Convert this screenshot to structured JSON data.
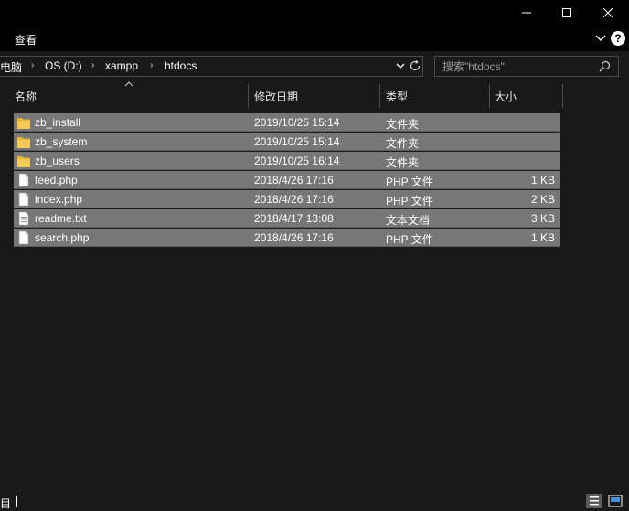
{
  "window": {
    "min_icon": "minimize-icon",
    "max_icon": "maximize-icon",
    "close_icon": "close-icon"
  },
  "ribbon": {
    "tab_view": "查看",
    "help_label": "?"
  },
  "address": {
    "crumbs": [
      "电脑",
      "OS (D:)",
      "xampp",
      "htdocs"
    ],
    "separator": "›"
  },
  "search": {
    "placeholder": "搜索\"htdocs\""
  },
  "columns": {
    "name": "名称",
    "modified": "修改日期",
    "type": "类型",
    "size": "大小"
  },
  "files": [
    {
      "name": "zb_install",
      "modified": "2019/10/25 15:14",
      "type": "文件夹",
      "size": "",
      "icon": "folder-icon"
    },
    {
      "name": "zb_system",
      "modified": "2019/10/25 15:14",
      "type": "文件夹",
      "size": "",
      "icon": "folder-icon"
    },
    {
      "name": "zb_users",
      "modified": "2019/10/25 16:14",
      "type": "文件夹",
      "size": "",
      "icon": "folder-icon"
    },
    {
      "name": "feed.php",
      "modified": "2018/4/26 17:16",
      "type": "PHP 文件",
      "size": "1 KB",
      "icon": "file-icon"
    },
    {
      "name": "index.php",
      "modified": "2018/4/26 17:16",
      "type": "PHP 文件",
      "size": "2 KB",
      "icon": "file-icon"
    },
    {
      "name": "readme.txt",
      "modified": "2018/4/17 13:08",
      "type": "文本文档",
      "size": "3 KB",
      "icon": "text-file-icon"
    },
    {
      "name": "search.php",
      "modified": "2018/4/26 17:16",
      "type": "PHP 文件",
      "size": "1 KB",
      "icon": "file-icon"
    }
  ],
  "status": {
    "left_text": "目"
  },
  "colors": {
    "selection": "#777777",
    "background": "#191919",
    "folder": "#e8b63a"
  }
}
